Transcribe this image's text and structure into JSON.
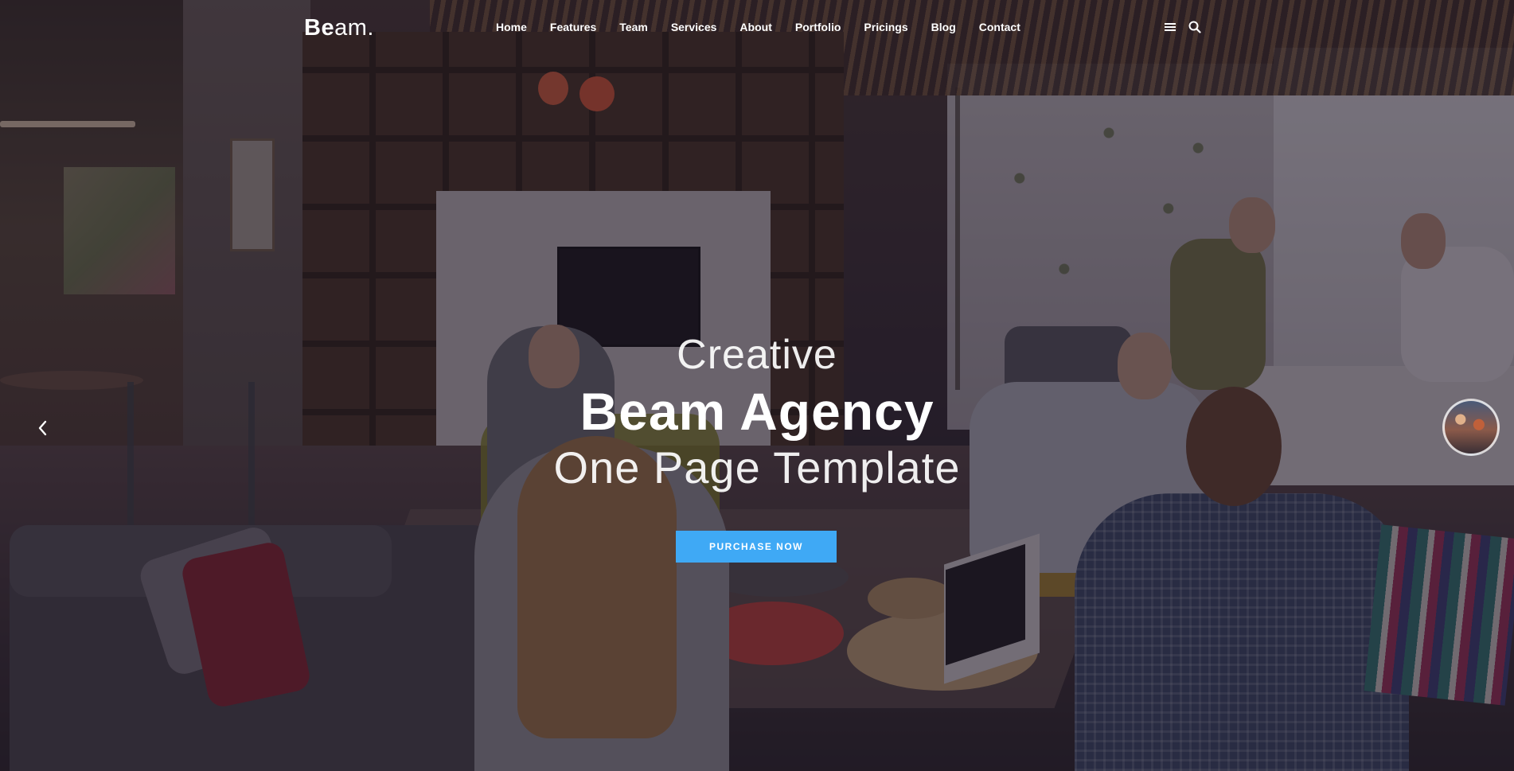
{
  "logo": {
    "first": "Be",
    "rest": "am."
  },
  "nav": {
    "items": [
      {
        "label": "Home"
      },
      {
        "label": "Features"
      },
      {
        "label": "Team"
      },
      {
        "label": "Services"
      },
      {
        "label": "About"
      },
      {
        "label": "Portfolio"
      },
      {
        "label": "Pricings"
      },
      {
        "label": "Blog"
      },
      {
        "label": "Contact"
      }
    ],
    "icons": [
      "menu-icon",
      "search-icon"
    ]
  },
  "hero": {
    "line1": "Creative",
    "title": "Beam Agency",
    "line3": "One Page Template",
    "cta_label": "PURCHASE NOW"
  },
  "slider": {
    "prev_icon": "chevron-left-icon",
    "thumb_icon": "slide-thumbnail"
  },
  "colors": {
    "accent": "#3fa9f5",
    "text": "#ffffff",
    "overlay": "#1c1422"
  }
}
